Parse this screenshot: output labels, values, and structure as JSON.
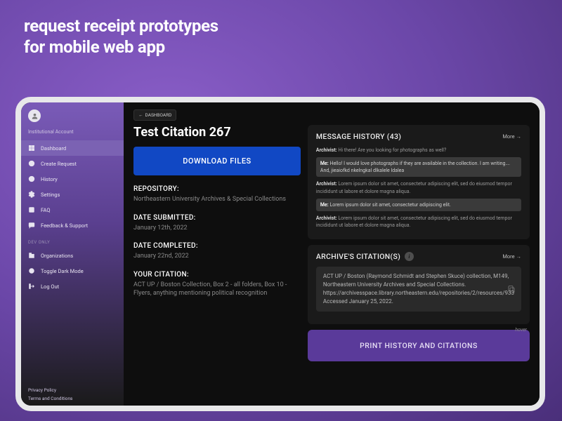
{
  "page_heading_line1": "request receipt prototypes",
  "page_heading_line2": "for mobile web app",
  "sidebar": {
    "account_label": "Institutional Account",
    "items": [
      {
        "label": "Dashboard"
      },
      {
        "label": "Create Request"
      },
      {
        "label": "History"
      },
      {
        "label": "Settings"
      },
      {
        "label": "FAQ"
      },
      {
        "label": "Feedback & Support"
      }
    ],
    "dev_label": "DEV ONLY",
    "dev_items": [
      {
        "label": "Organizations"
      },
      {
        "label": "Toggle Dark Mode"
      },
      {
        "label": "Log Out"
      }
    ],
    "footer": {
      "privacy": "Privacy Policy",
      "terms": "Terms and Conditions"
    }
  },
  "back_button": "DASHBOARD",
  "citation": {
    "title": "Test Citation 267",
    "download_label": "DOWNLOAD FILES",
    "repository_label": "REPOSITORY:",
    "repository_value": "Northeastern University Archives & Special Collections",
    "submitted_label": "DATE SUBMITTED:",
    "submitted_value": "January 12th, 2022",
    "completed_label": "DATE COMPLETED:",
    "completed_value": "January 22nd, 2022",
    "your_citation_label": "YOUR CITATION:",
    "your_citation_value": "ACT UP / Boston Collection, Box 2 - all folders, Box 10 - Flyers, anything mentioning political recognition"
  },
  "messages": {
    "title": "MESSAGE  HISTORY (43)",
    "more_label": "More →",
    "items": [
      {
        "who": "Archivist:",
        "text": " Hi there! Are you looking for photographs as well?",
        "role": "archivist"
      },
      {
        "who": "Me:",
        "text": " Hello! I would love photographs if they are available in the collection. I am writing…. And, jieaiofkd nkelngkal dlkalele ldalea",
        "role": "me"
      },
      {
        "who": "Archivist:",
        "text": "  Lorem ipsum dolor sit amet, consectetur adipiscing elit, sed do eiusmod tempor incididunt ut labore et dolore magna aliqua.",
        "role": "archivist"
      },
      {
        "who": "Me:",
        "text": " Lorem ipsum dolor sit amet, consectetur adipiscing elit.",
        "role": "me"
      },
      {
        "who": "Archivist:",
        "text": "  Lorem ipsum dolor sit amet, consectetur adipiscing elit, sed do eiusmod tempor incididunt ut labore et dolore magna aliqua.",
        "role": "archivist"
      }
    ]
  },
  "archive_citations": {
    "title": "ARCHIVE'S CITATION(S)",
    "more_label": "More →",
    "hover_label": "hover",
    "text": "ACT UP / Boston (Raymond Schmidt and Stephen Skuce) collection, M149, Northeastern University Archives and Special Collections. https://archivesspace.library.northeastern.edu/repositories/2/resources/933 Accessed January 25, 2022."
  },
  "print_button": "PRINT HISTORY AND CITATIONS"
}
